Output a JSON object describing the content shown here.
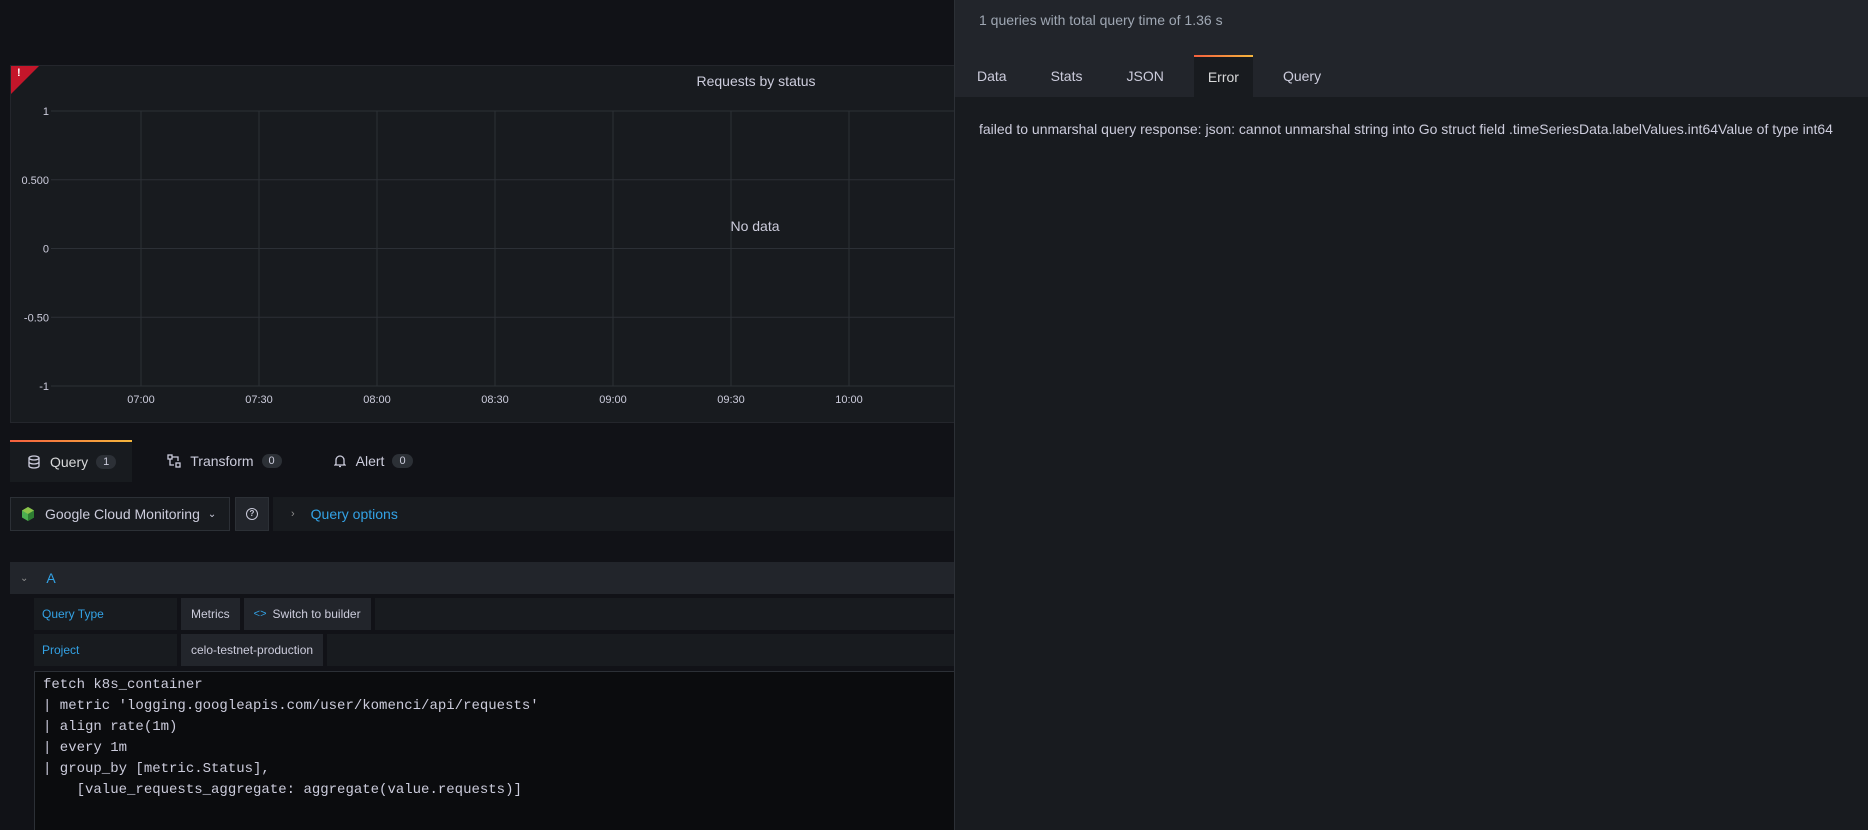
{
  "panel": {
    "title": "Requests by status",
    "error_glyph": "!",
    "no_data": "No data"
  },
  "chart_data": {
    "type": "line",
    "title": "Requests by status",
    "y_ticks": [
      "1",
      "0.500",
      "0",
      "-0.50",
      "-1"
    ],
    "x_ticks": [
      "07:00",
      "07:30",
      "08:00",
      "08:30",
      "09:00",
      "09:30",
      "10:00"
    ],
    "ylim": [
      -1,
      1
    ],
    "series": [],
    "grid": true,
    "no_data_text": "No data"
  },
  "query_tabs": [
    {
      "label": "Query",
      "count": "1",
      "icon": "database-icon",
      "active": true
    },
    {
      "label": "Transform",
      "count": "0",
      "icon": "transform-icon",
      "active": false
    },
    {
      "label": "Alert",
      "count": "0",
      "icon": "bell-icon",
      "active": false
    }
  ],
  "toolbar": {
    "datasource": "Google Cloud Monitoring",
    "query_options": "Query options"
  },
  "query_row": {
    "name": "A",
    "query_type_label": "Query Type",
    "query_type_value": "Metrics",
    "switch_label": "Switch to builder",
    "switch_icon": "<>",
    "project_label": "Project",
    "project_value": "celo-testnet-production",
    "code_lines": [
      "fetch k8s_container",
      "| metric 'logging.googleapis.com/user/komenci/api/requests'",
      "| align rate(1m)",
      "| every 1m",
      "| group_by [metric.Status],",
      "    [value_requests_aggregate: aggregate(value.requests)]"
    ]
  },
  "drawer": {
    "subtitle": "1 queries with total query time of 1.36 s",
    "tabs": [
      "Data",
      "Stats",
      "JSON",
      "Error",
      "Query"
    ],
    "active_tab": "Error",
    "error_message": "failed to unmarshal query response: json: cannot unmarshal string into Go struct field .timeSeriesData.labelValues.int64Value of type int64"
  },
  "colors": {
    "accent_blue": "#33a2e5",
    "error_red": "#c4162a",
    "tab_gradient_start": "#f55f3e",
    "tab_gradient_end": "#f5b73d"
  }
}
